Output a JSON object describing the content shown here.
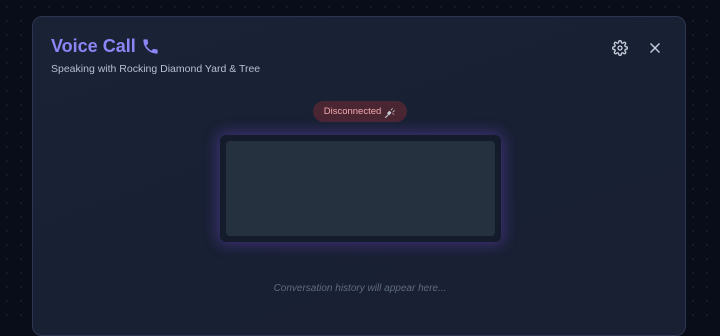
{
  "modal": {
    "title": "Voice Call",
    "subtitle": "Speaking with Rocking Diamond Yard & Tree",
    "title_icon": "phone-icon",
    "settings_icon": "gear-icon",
    "close_icon": "close-icon"
  },
  "status": {
    "label": "Disconnected",
    "icon": "plug-icon"
  },
  "conversation": {
    "placeholder": "Conversation history will appear here..."
  },
  "colors": {
    "accent": "#8b85f5",
    "status_bg": "#4a2632",
    "status_text": "#f3a9ae",
    "glow": "#7e50e6"
  }
}
